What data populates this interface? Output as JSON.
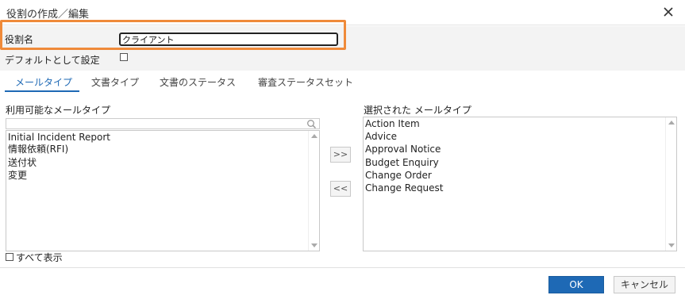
{
  "dialog": {
    "title": "役割の作成／編集"
  },
  "form": {
    "role_label": "役割名",
    "role_value": "クライアント",
    "default_label": "デフォルトとして設定"
  },
  "tabs": [
    {
      "label": "メールタイプ",
      "active": true
    },
    {
      "label": "文書タイプ",
      "active": false
    },
    {
      "label": "文書のステータス",
      "active": false
    },
    {
      "label": "審査ステータスセット",
      "active": false
    }
  ],
  "available": {
    "title": "利用可能なメールタイプ",
    "search_placeholder": "",
    "items": [
      "Initial Incident Report",
      "情報依頼(RFI)",
      "送付状",
      "変更"
    ]
  },
  "selected": {
    "title": "選択された メールタイプ",
    "items": [
      "Action Item",
      "Advice",
      "Approval Notice",
      "Budget Enquiry",
      "Change Order",
      "Change Request"
    ]
  },
  "move_buttons": {
    "add": ">>",
    "remove": "<<"
  },
  "show_all_label": "すべて表示",
  "footer": {
    "ok": "OK",
    "cancel": "キャンセル"
  },
  "colors": {
    "accent": "#1e69b5",
    "highlight": "#ef8a3a"
  },
  "icons": {
    "close": "close-icon",
    "search": "search-icon",
    "scroll_up": "chevron-up-icon",
    "scroll_down": "chevron-down-icon"
  }
}
